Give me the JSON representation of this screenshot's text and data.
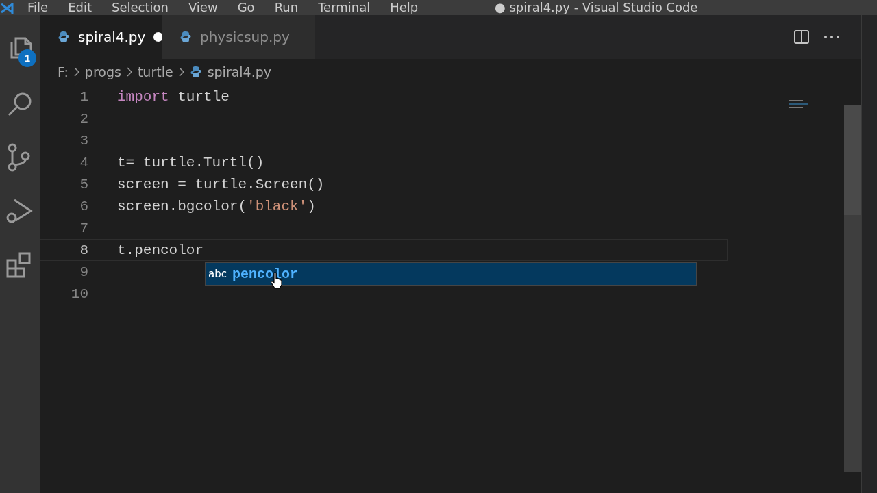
{
  "menu": [
    "File",
    "Edit",
    "Selection",
    "View",
    "Go",
    "Run",
    "Terminal",
    "Help"
  ],
  "window": {
    "title": "● spiral4.py - Visual Studio Code"
  },
  "activity_bar": {
    "explorer_badge": "1"
  },
  "tabs": [
    {
      "label": "spiral4.py",
      "selected": true,
      "modified": true
    },
    {
      "label": "physicsup.py",
      "selected": false,
      "modified": false
    }
  ],
  "breadcrumbs": [
    "F:",
    "progs",
    "turtle",
    "spiral4.py"
  ],
  "editor": {
    "lines": [
      {
        "number": "1",
        "current": false,
        "tokens": [
          {
            "text": "import",
            "kind": "keyword"
          },
          {
            "text": " turtle",
            "kind": "plain"
          }
        ]
      },
      {
        "number": "2",
        "current": false
      },
      {
        "number": "3",
        "current": false
      },
      {
        "number": "4",
        "current": false,
        "tokens": [
          {
            "text": "t= turtle.Turtl()",
            "kind": "plain"
          }
        ]
      },
      {
        "number": "5",
        "current": false,
        "tokens": [
          {
            "text": "screen = turtle.Screen()",
            "kind": "plain"
          }
        ]
      },
      {
        "number": "6",
        "current": false,
        "tokens": [
          {
            "text": "screen.bgcolor(",
            "kind": "plain"
          },
          {
            "text": "'black'",
            "kind": "string"
          },
          {
            "text": ")",
            "kind": "plain"
          }
        ]
      },
      {
        "number": "7",
        "current": false
      },
      {
        "number": "8",
        "current": true,
        "tokens": [
          {
            "text": "t.pencolor",
            "kind": "plain"
          }
        ]
      },
      {
        "number": "9",
        "current": false
      },
      {
        "number": "10",
        "current": false
      }
    ],
    "suggestions": [
      {
        "kind_label": "abc",
        "label": "pencolor",
        "selected": true
      }
    ]
  }
}
